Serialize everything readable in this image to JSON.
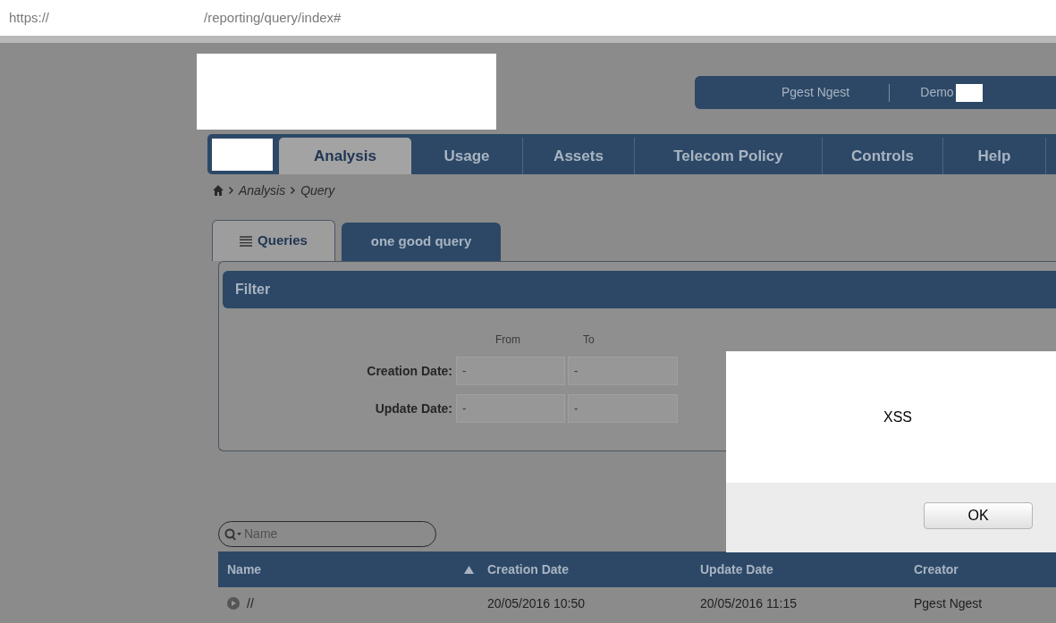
{
  "address_bar": {
    "scheme": "https://",
    "path": "/reporting/query/index#"
  },
  "header_user": {
    "name": "Pgest Ngest",
    "account": "Demo"
  },
  "nav_tabs": [
    {
      "label": "Analysis",
      "selected": true
    },
    {
      "label": "Usage",
      "selected": false
    },
    {
      "label": "Assets",
      "selected": false
    },
    {
      "label": "Telecom Policy",
      "selected": false
    },
    {
      "label": "Controls",
      "selected": false
    },
    {
      "label": "Help",
      "selected": false
    }
  ],
  "breadcrumb": [
    "Analysis",
    "Query"
  ],
  "query_tabs": [
    {
      "label": "Queries",
      "selected": true
    },
    {
      "label": "one good query",
      "selected": false
    }
  ],
  "filter": {
    "title": "Filter",
    "from_label": "From",
    "to_label": "To",
    "fields": [
      {
        "label": "Creation Date:",
        "from": "-",
        "to": "-"
      },
      {
        "label": "Update Date:",
        "from": "-",
        "to": "-"
      }
    ]
  },
  "dialog": {
    "message": "XSS",
    "button": "OK"
  },
  "search": {
    "placeholder": "Name"
  },
  "table": {
    "columns": [
      {
        "label": "Name",
        "sorted": true
      },
      {
        "label": "Creation Date",
        "sorted": false
      },
      {
        "label": "Update Date",
        "sorted": false
      },
      {
        "label": "Creator",
        "sorted": false
      }
    ],
    "rows": [
      {
        "cells": [
          "//",
          "20/05/2016 10:50",
          "20/05/2016 11:15",
          "Pgest Ngest"
        ]
      }
    ]
  }
}
